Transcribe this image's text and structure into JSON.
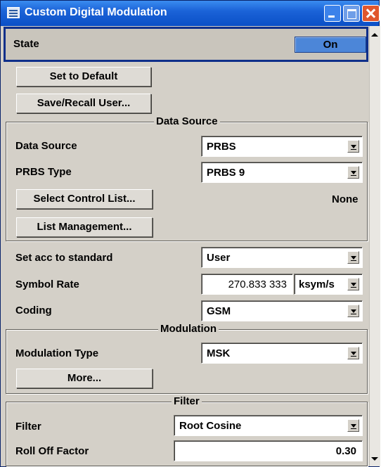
{
  "window": {
    "title": "Custom Digital Modulation"
  },
  "state": {
    "label": "State",
    "button": "On"
  },
  "buttons": {
    "set_default": "Set to Default",
    "save_recall": "Save/Recall User..."
  },
  "data_source": {
    "group_title": "Data Source",
    "source_label": "Data Source",
    "source_value": "PRBS",
    "prbs_label": "PRBS Type",
    "prbs_value": "PRBS 9",
    "select_control_list": "Select Control List...",
    "control_list_value": "None",
    "list_management": "List Management..."
  },
  "standard": {
    "label": "Set acc to standard",
    "value": "User"
  },
  "symbol_rate": {
    "label": "Symbol Rate",
    "value": "270.833 333",
    "unit": "ksym/s"
  },
  "coding": {
    "label": "Coding",
    "value": "GSM"
  },
  "modulation": {
    "group_title": "Modulation",
    "type_label": "Modulation Type",
    "type_value": "MSK",
    "more": "More..."
  },
  "filter": {
    "group_title": "Filter",
    "filter_label": "Filter",
    "filter_value": "Root Cosine",
    "rolloff_label": "Roll Off Factor",
    "rolloff_value": "0.30"
  },
  "colors": {
    "titlebar": "#1b63d8",
    "state_on": "#4c86d8",
    "panel": "#d4d0c8"
  }
}
